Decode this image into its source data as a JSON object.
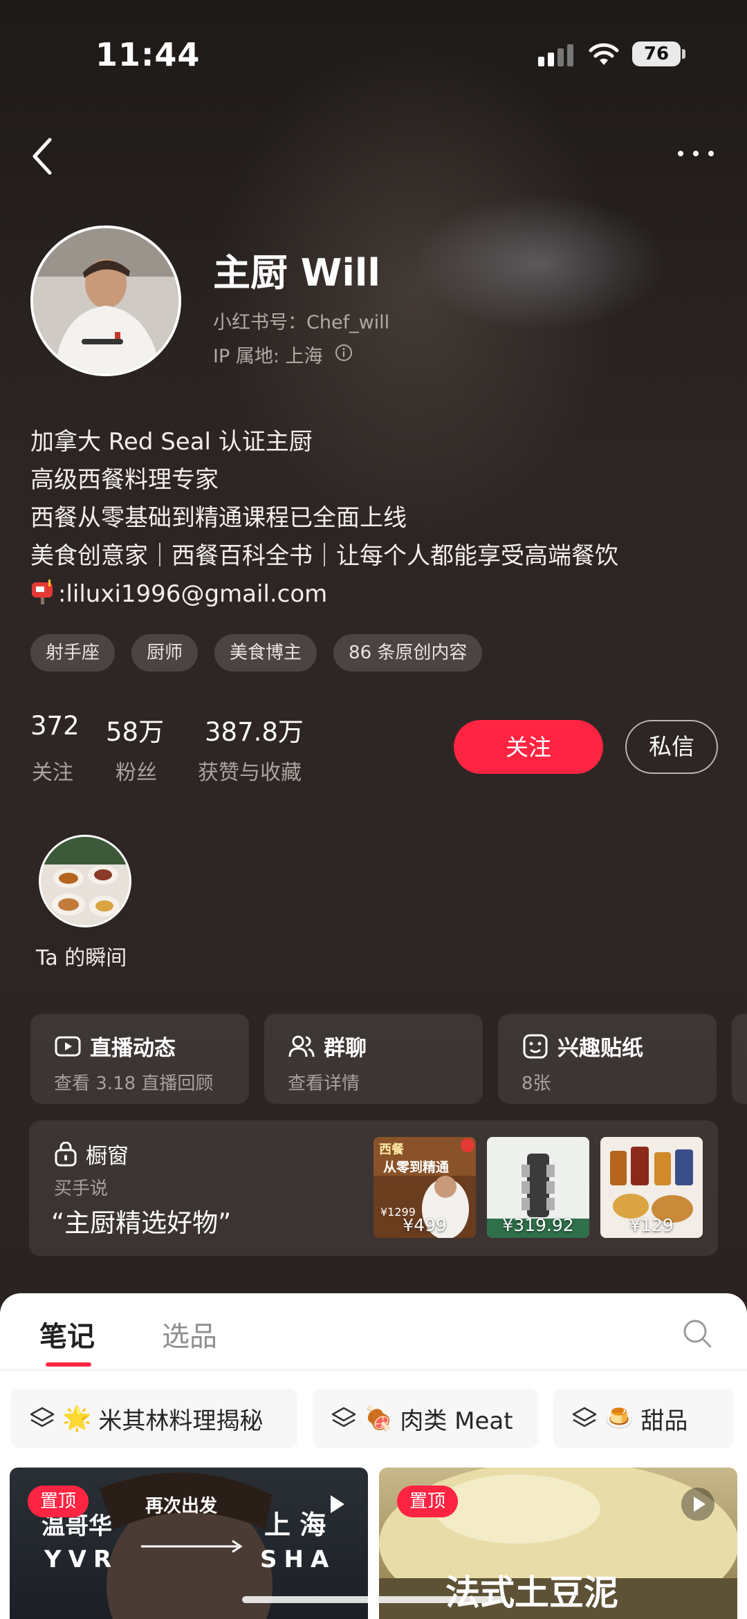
{
  "status_bar": {
    "time": "11:44",
    "battery": "76"
  },
  "profile": {
    "name": "主厨 Will",
    "red_id": "小红书号：Chef_will",
    "ip": "IP 属地: 上海",
    "bio": [
      "加拿大 Red Seal 认证主厨",
      "高级西餐料理专家",
      "西餐从零基础到精通课程已全面上线",
      "美食创意家｜西餐百科全书｜让每个人都能享受高端餐饮"
    ],
    "email": ":liluxi1996@gmail.com",
    "tags": [
      "射手座",
      "厨师",
      "美食博主",
      "86 条原创内容"
    ]
  },
  "stats": [
    {
      "value": "372",
      "label": "关注"
    },
    {
      "value": "58万",
      "label": "粉丝"
    },
    {
      "value": "387.8万",
      "label": "获赞与收藏"
    }
  ],
  "actions": {
    "follow": "关注",
    "message": "私信"
  },
  "moment": {
    "label": "Ta 的瞬间"
  },
  "cards": [
    {
      "title": "直播动态",
      "sub": "查看 3.18 直播回顾",
      "icon": "live-video-icon"
    },
    {
      "title": "群聊",
      "sub": "查看详情",
      "icon": "group-chat-icon"
    },
    {
      "title": "兴趣贴纸",
      "sub": "8张",
      "icon": "sticker-icon"
    }
  ],
  "shop": {
    "title": "橱窗",
    "sub": "买手说",
    "quote": "“主厨精选好物”",
    "products": [
      {
        "price": "¥499",
        "poster_title": "西餐",
        "poster_sub": "从零到精通",
        "poster_price": "¥1299"
      },
      {
        "price": "¥319.92"
      },
      {
        "price": "¥129"
      }
    ]
  },
  "tabs": {
    "notes": "笔记",
    "selected": "选品"
  },
  "collections": [
    {
      "emoji": "🌟",
      "label": "米其林料理揭秘"
    },
    {
      "emoji": "🍖",
      "label": "肉类 Meat"
    },
    {
      "emoji": "🍮",
      "label": "甜品"
    }
  ],
  "notes": [
    {
      "pin": "置顶",
      "top_text": "再次出发",
      "from_city": "温哥华",
      "to_city": "上 海",
      "from_code": "YVR",
      "to_code": "SHA"
    },
    {
      "pin": "置顶",
      "title": "法式土豆泥"
    }
  ],
  "colors": {
    "accent": "#ff2442",
    "background": "#2a2220"
  }
}
